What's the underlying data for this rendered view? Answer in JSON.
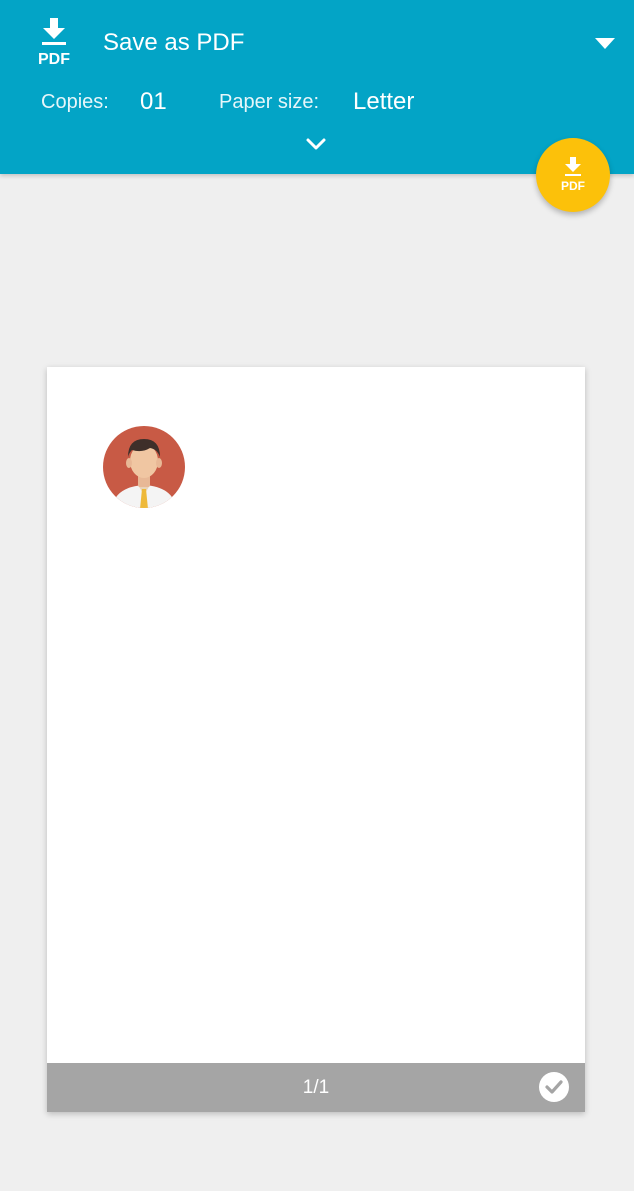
{
  "header": {
    "printer_name": "Save as PDF",
    "pdf_icon_text": "PDF",
    "copies_label": "Copies:",
    "copies_value": "01",
    "paper_size_label": "Paper size:",
    "paper_size_value": "Letter"
  },
  "fab": {
    "icon": "download-pdf-icon",
    "text": "PDF"
  },
  "preview": {
    "page_number": "1/1",
    "page_selected": true
  },
  "colors": {
    "header_background": "#03a4c6",
    "fab_background": "#fcc10a",
    "background": "#efefef",
    "page_footer": "#a5a5a5",
    "avatar_background": "#c85a45"
  },
  "icons": {
    "header_icon": "download-pdf-icon",
    "dropdown": "triangle-down-icon",
    "expand": "chevron-down-icon",
    "page_check": "check-circle-icon",
    "preview_image": "person-avatar-icon"
  }
}
